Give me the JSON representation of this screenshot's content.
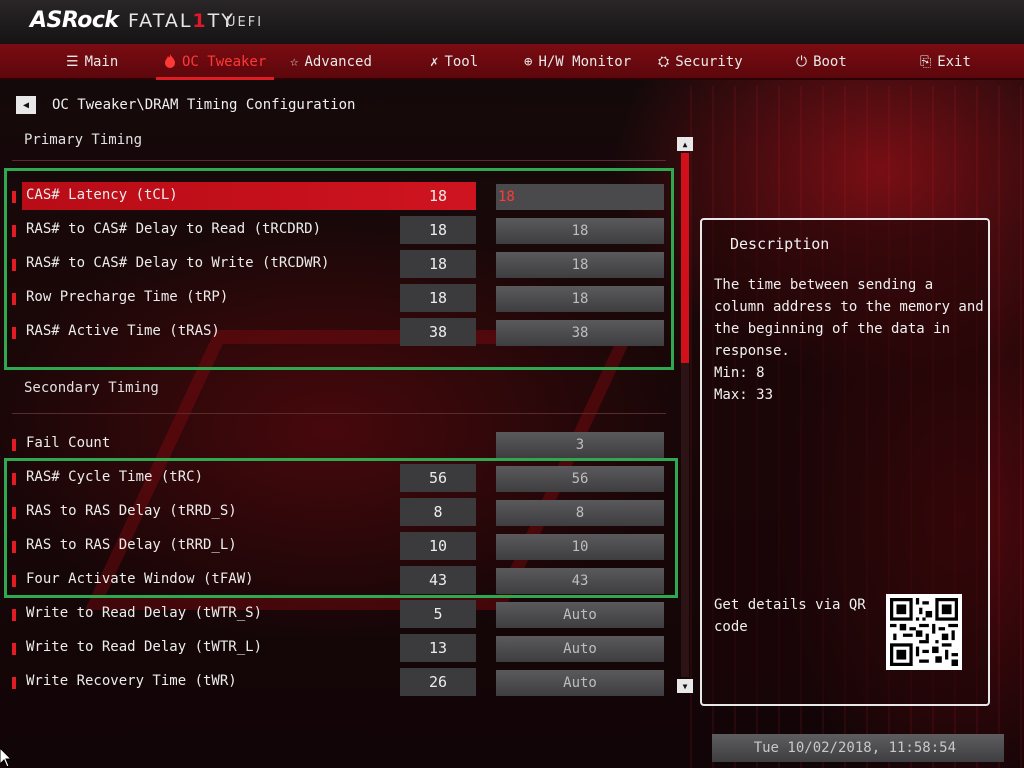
{
  "brand": {
    "asrock": "ASRock",
    "fatal_a": "FATAL",
    "fatal_one": "1",
    "fatal_b": "TY",
    "uefi": "UEFI"
  },
  "nav": {
    "tabs": [
      {
        "label": "Main",
        "icon": "list-icon"
      },
      {
        "label": "OC Tweaker",
        "icon": "flame-icon",
        "active": true
      },
      {
        "label": "Advanced",
        "icon": "star-icon"
      },
      {
        "label": "Tool",
        "icon": "tools-icon"
      },
      {
        "label": "H/W Monitor",
        "icon": "crosshair-icon"
      },
      {
        "label": "Security",
        "icon": "shield-icon"
      },
      {
        "label": "Boot",
        "icon": "power-icon"
      },
      {
        "label": "Exit",
        "icon": "exit-icon"
      }
    ]
  },
  "breadcrumb": "OC Tweaker\\DRAM Timing Configuration",
  "sections": {
    "primary": "Primary Timing",
    "secondary": "Secondary Timing"
  },
  "rows": [
    {
      "label": "CAS# Latency (tCL)",
      "current": "18",
      "value": "18"
    },
    {
      "label": "RAS# to CAS# Delay to Read  (tRCDRD)",
      "current": "18",
      "value": "18"
    },
    {
      "label": "RAS# to CAS# Delay to Write (tRCDWR)",
      "current": "18",
      "value": "18"
    },
    {
      "label": "Row Precharge Time (tRP)",
      "current": "18",
      "value": "18"
    },
    {
      "label": "RAS# Active Time (tRAS)",
      "current": "38",
      "value": "38"
    },
    {
      "label": "Fail Count",
      "current": "",
      "value": "3"
    },
    {
      "label": "RAS# Cycle Time (tRC)",
      "current": "56",
      "value": "56"
    },
    {
      "label": "RAS to RAS Delay (tRRD_S)",
      "current": "8",
      "value": "8"
    },
    {
      "label": "RAS to RAS Delay (tRRD_L)",
      "current": "10",
      "value": "10"
    },
    {
      "label": "Four Activate Window (tFAW)",
      "current": "43",
      "value": "43"
    },
    {
      "label": "Write to Read Delay (tWTR_S)",
      "current": "5",
      "value": "Auto"
    },
    {
      "label": "Write to Read Delay (tWTR_L)",
      "current": "13",
      "value": "Auto"
    },
    {
      "label": "Write Recovery Time (tWR)",
      "current": "26",
      "value": "Auto"
    }
  ],
  "scroll": {
    "position": 0.0,
    "visible_fraction": 0.4
  },
  "description": {
    "title": "Description",
    "text": "The time between sending a column address to the memory and the beginning of the data in response.",
    "min": "Min: 8",
    "max": "Max: 33",
    "qr_text": "Get details via QR code"
  },
  "clock": "Tue 10/02/2018, 11:58:54",
  "colors": {
    "accent": "#e01c24",
    "highlight": "#2fa84f"
  }
}
